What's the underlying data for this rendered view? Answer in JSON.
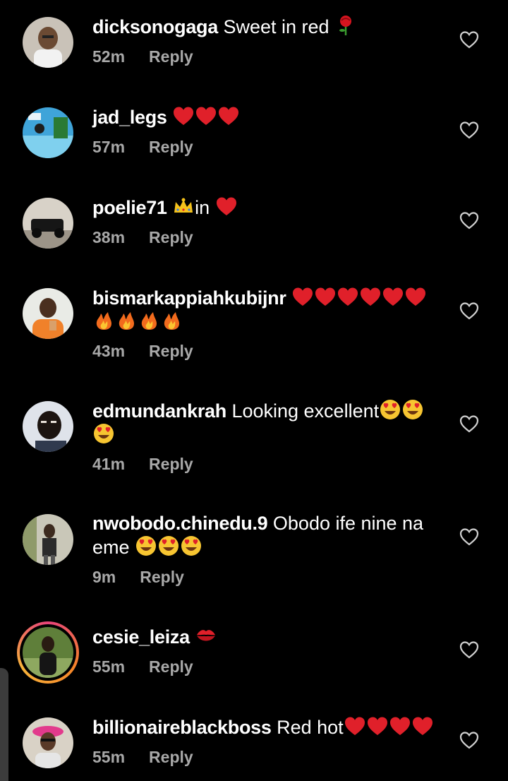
{
  "colors": {
    "background": "#000000",
    "text": "#ffffff",
    "meta": "#a8a8a8",
    "heart": "#e0202a",
    "story_ring": "#e8437a"
  },
  "reply_label": "Reply",
  "comments": [
    {
      "username": "dicksonogaga",
      "text": "Sweet in red",
      "emojis_after": [
        "rose"
      ],
      "time": "52m"
    },
    {
      "username": "jad_legs",
      "text": "",
      "emojis_after": [
        "red-heart",
        "red-heart",
        "red-heart"
      ],
      "time": "57m"
    },
    {
      "username": "poelie71",
      "text": "in",
      "emojis_before": [
        "crown"
      ],
      "emojis_after": [
        "red-heart"
      ],
      "time": "38m"
    },
    {
      "username": "bismarkappiahkubijnr",
      "text": "",
      "emojis_after": [
        "red-heart",
        "red-heart",
        "red-heart",
        "red-heart",
        "red-heart",
        "red-heart"
      ],
      "emojis_line2": [
        "fire",
        "fire",
        "fire",
        "fire"
      ],
      "time": "43m"
    },
    {
      "username": "edmundankrah",
      "text": "Looking excellent",
      "emojis_after": [
        "heart-eyes",
        "heart-eyes"
      ],
      "emojis_line2": [
        "heart-eyes"
      ],
      "time": "41m"
    },
    {
      "username": "nwobodo.chinedu.9",
      "text": "Obodo ife nine na",
      "text_line2": "eme",
      "emojis_line2": [
        "heart-eyes",
        "heart-eyes",
        "heart-eyes"
      ],
      "time": "9m"
    },
    {
      "username": "cesie_leiza",
      "text": "",
      "emojis_after": [
        "kiss-mark"
      ],
      "time": "55m",
      "has_story": true
    },
    {
      "username": "billionaireblackboss",
      "text": "Red hot",
      "emojis_after": [
        "red-heart",
        "red-heart",
        "red-heart",
        "red-heart"
      ],
      "time": "55m"
    }
  ]
}
